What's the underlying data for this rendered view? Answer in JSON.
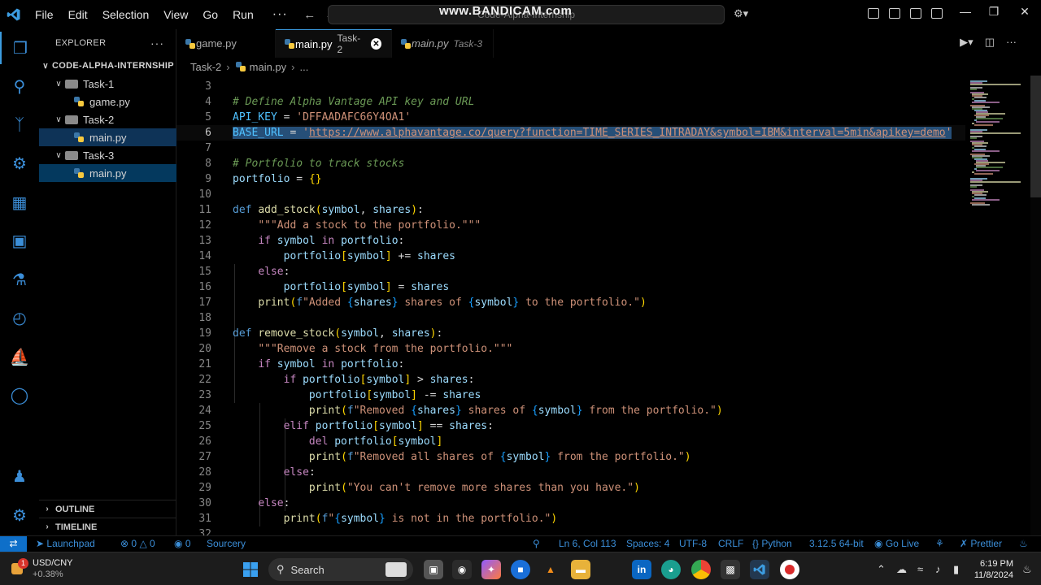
{
  "titlebar": {
    "menu": [
      "File",
      "Edit",
      "Selection",
      "View",
      "Go",
      "Run"
    ],
    "more": "···",
    "command_center": "Code-Alpha-Internship",
    "watermark": "www.BANDICAM.com"
  },
  "sidebar": {
    "header": "EXPLORER",
    "more": "···",
    "root": "CODE-ALPHA-INTERNSHIP",
    "tree": [
      {
        "type": "folder",
        "label": "Task-1"
      },
      {
        "type": "file",
        "label": "game.py"
      },
      {
        "type": "folder",
        "label": "Task-2"
      },
      {
        "type": "file",
        "label": "main.py"
      },
      {
        "type": "folder",
        "label": "Task-3"
      },
      {
        "type": "file",
        "label": "main.py"
      }
    ],
    "outline": "OUTLINE",
    "timeline": "TIMELINE"
  },
  "tabs": [
    {
      "name": "game.py",
      "desc": ""
    },
    {
      "name": "main.py",
      "desc": "Task-2"
    },
    {
      "name": "main.py",
      "desc": "Task-3"
    }
  ],
  "breadcrumb": {
    "folder": "Task-2",
    "file": "main.py",
    "more": "..."
  },
  "editor": {
    "line_numbers": [
      "3",
      "4",
      "5",
      "6",
      "7",
      "8",
      "9",
      "10",
      "11",
      "12",
      "13",
      "14",
      "15",
      "16",
      "17",
      "18",
      "19",
      "20",
      "21",
      "22",
      "23",
      "24",
      "25",
      "26",
      "27",
      "28",
      "29",
      "30",
      "31",
      "32"
    ],
    "lines": [
      "",
      "# Define Alpha Vantage API key and URL",
      "API_KEY = 'DFFAADAFC66Y4OA1'",
      "BASE_URL = 'https://www.alphavantage.co/query?function=TIME_SERIES_INTRADAY&symbol=IBM&interval=5min&apikey=demo'",
      "",
      "# Portfolio to track stocks",
      "portfolio = {}",
      "",
      "def add_stock(symbol, shares):",
      "    \"\"\"Add a stock to the portfolio.\"\"\"",
      "    if symbol in portfolio:",
      "        portfolio[symbol] += shares",
      "    else:",
      "        portfolio[symbol] = shares",
      "    print(f\"Added {shares} shares of {symbol} to the portfolio.\")",
      "",
      "def remove_stock(symbol, shares):",
      "    \"\"\"Remove a stock from the portfolio.\"\"\"",
      "    if symbol in portfolio:",
      "        if portfolio[symbol] > shares:",
      "            portfolio[symbol] -= shares",
      "            print(f\"Removed {shares} shares of {symbol} from the portfolio.\")",
      "        elif portfolio[symbol] == shares:",
      "            del portfolio[symbol]",
      "            print(f\"Removed all shares of {symbol} from the portfolio.\")",
      "        else:",
      "            print(\"You can't remove more shares than you have.\")",
      "    else:",
      "        print(f\"{symbol} is not in the portfolio.\")",
      ""
    ],
    "current_line": "6"
  },
  "statusbar": {
    "launchpad": "Launchpad",
    "errors": "0",
    "warnings": "0",
    "ports": "0",
    "sourcery": "Sourcery",
    "position": "Ln 6, Col 113",
    "spaces": "Spaces: 4",
    "encoding": "UTF-8",
    "eol": "CRLF",
    "language": "Python",
    "interpreter": "3.12.5 64-bit",
    "go_live": "Go Live",
    "prettier": "Prettier"
  },
  "taskbar": {
    "weather_title": "USD/CNY",
    "weather_value": "+0.38%",
    "weather_badge": "1",
    "search": "Search",
    "time": "6:19 PM",
    "date": "11/8/2024"
  },
  "colors": {
    "accent": "#3c9ce0",
    "selection": "#264f78",
    "sidebar_selected": "#0e3357"
  }
}
